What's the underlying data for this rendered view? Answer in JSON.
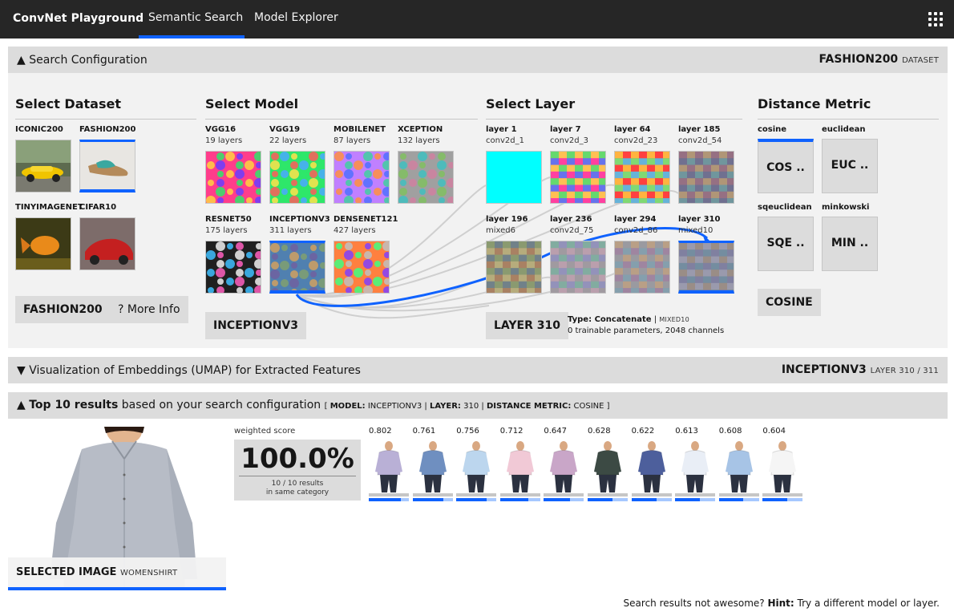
{
  "app": {
    "title": "ConvNet Playground"
  },
  "tabs": [
    {
      "label": "Semantic Search",
      "active": true
    },
    {
      "label": "Model Explorer",
      "active": false
    }
  ],
  "config_header": {
    "toggle": "▲",
    "label": "Search Configuration",
    "dataset_value": "FASHION200",
    "dataset_tag": "DATASET"
  },
  "dataset": {
    "title": "Select Dataset",
    "items": [
      {
        "name": "ICONIC200",
        "selected": false
      },
      {
        "name": "FASHION200",
        "selected": true
      },
      {
        "name": "TINYIMAGENET",
        "selected": false
      },
      {
        "name": "CIFAR10",
        "selected": false
      }
    ],
    "button": "FASHION200",
    "more_info": "? More Info"
  },
  "model": {
    "title": "Select Model",
    "items": [
      {
        "name": "VGG16",
        "layers": "19 layers"
      },
      {
        "name": "VGG19",
        "layers": "22 layers"
      },
      {
        "name": "MOBILENET",
        "layers": "87 layers"
      },
      {
        "name": "XCEPTION",
        "layers": "132 layers"
      },
      {
        "name": "RESNET50",
        "layers": "175 layers"
      },
      {
        "name": "INCEPTIONV3",
        "layers": "311 layers"
      },
      {
        "name": "DENSENET121",
        "layers": "427 layers"
      }
    ],
    "selected": "INCEPTIONV3",
    "button": "INCEPTIONV3"
  },
  "layer": {
    "title": "Select Layer",
    "items": [
      {
        "name": "layer 1",
        "sub": "conv2d_1"
      },
      {
        "name": "layer 7",
        "sub": "conv2d_3"
      },
      {
        "name": "layer 64",
        "sub": "conv2d_23"
      },
      {
        "name": "layer 185",
        "sub": "conv2d_54"
      },
      {
        "name": "layer 196",
        "sub": "mixed6"
      },
      {
        "name": "layer 236",
        "sub": "conv2d_75"
      },
      {
        "name": "layer 294",
        "sub": "conv2d_86"
      },
      {
        "name": "layer 310",
        "sub": "mixed10"
      }
    ],
    "selected": "layer 310",
    "button": "LAYER 310",
    "info_type_label": "Type: Concatenate",
    "info_sep": "|",
    "info_type_tag": "MIXED10",
    "info_params": "0 trainable parameters, 2048 channels"
  },
  "metric": {
    "title": "Distance Metric",
    "items": [
      {
        "name": "cosine",
        "abbr": "COS ..",
        "selected": true
      },
      {
        "name": "euclidean",
        "abbr": "EUC ..",
        "selected": false
      },
      {
        "name": "sqeuclidean",
        "abbr": "SQE ..",
        "selected": false
      },
      {
        "name": "minkowski",
        "abbr": "MIN ..",
        "selected": false
      }
    ],
    "button": "COSINE"
  },
  "umap_header": {
    "toggle": "▼",
    "label": "Visualization of Embeddings (UMAP) for Extracted Features",
    "model": "INCEPTIONV3",
    "layer_tag": "LAYER 310 / 311"
  },
  "results_header": {
    "toggle": "▲",
    "label_bold": "Top 10 results",
    "label_rest": "based on your search configuration",
    "bracket_open": "[",
    "model_key": "MODEL:",
    "model_val": "INCEPTIONV3",
    "sep1": "|",
    "layer_key": "LAYER:",
    "layer_val": "310",
    "sep2": "|",
    "metric_key": "DISTANCE METRIC:",
    "metric_val": "COSINE",
    "bracket_close": "]"
  },
  "selected_image": {
    "label": "SELECTED IMAGE",
    "category": "WOMENSHIRT"
  },
  "score": {
    "label": "weighted score",
    "value": "100.0%",
    "line1": "10 / 10 results",
    "line2": "in same category"
  },
  "results": [
    {
      "score": "0.802",
      "fill": 0.802,
      "shirt": "#b9b0d6"
    },
    {
      "score": "0.761",
      "fill": 0.761,
      "shirt": "#6f8fc0"
    },
    {
      "score": "0.756",
      "fill": 0.756,
      "shirt": "#bcd6ee"
    },
    {
      "score": "0.712",
      "fill": 0.712,
      "shirt": "#f1c9d6"
    },
    {
      "score": "0.647",
      "fill": 0.647,
      "shirt": "#c9a6c8"
    },
    {
      "score": "0.628",
      "fill": 0.628,
      "shirt": "#3c4a44"
    },
    {
      "score": "0.622",
      "fill": 0.622,
      "shirt": "#4d5f9c"
    },
    {
      "score": "0.613",
      "fill": 0.613,
      "shirt": "#e9eef6"
    },
    {
      "score": "0.608",
      "fill": 0.608,
      "shirt": "#a7c4e6"
    },
    {
      "score": "0.604",
      "fill": 0.604,
      "shirt": "#f5f5f5"
    }
  ],
  "hint": {
    "lead": "Search results not awesome?",
    "bold": "Hint:",
    "text": "Try a different model or layer."
  },
  "colors": {
    "accent": "#0f62fe",
    "topbar": "#262626",
    "panel": "#f2f2f2",
    "header": "#dcdcdc",
    "layer1_cyan": "#00ffff"
  }
}
